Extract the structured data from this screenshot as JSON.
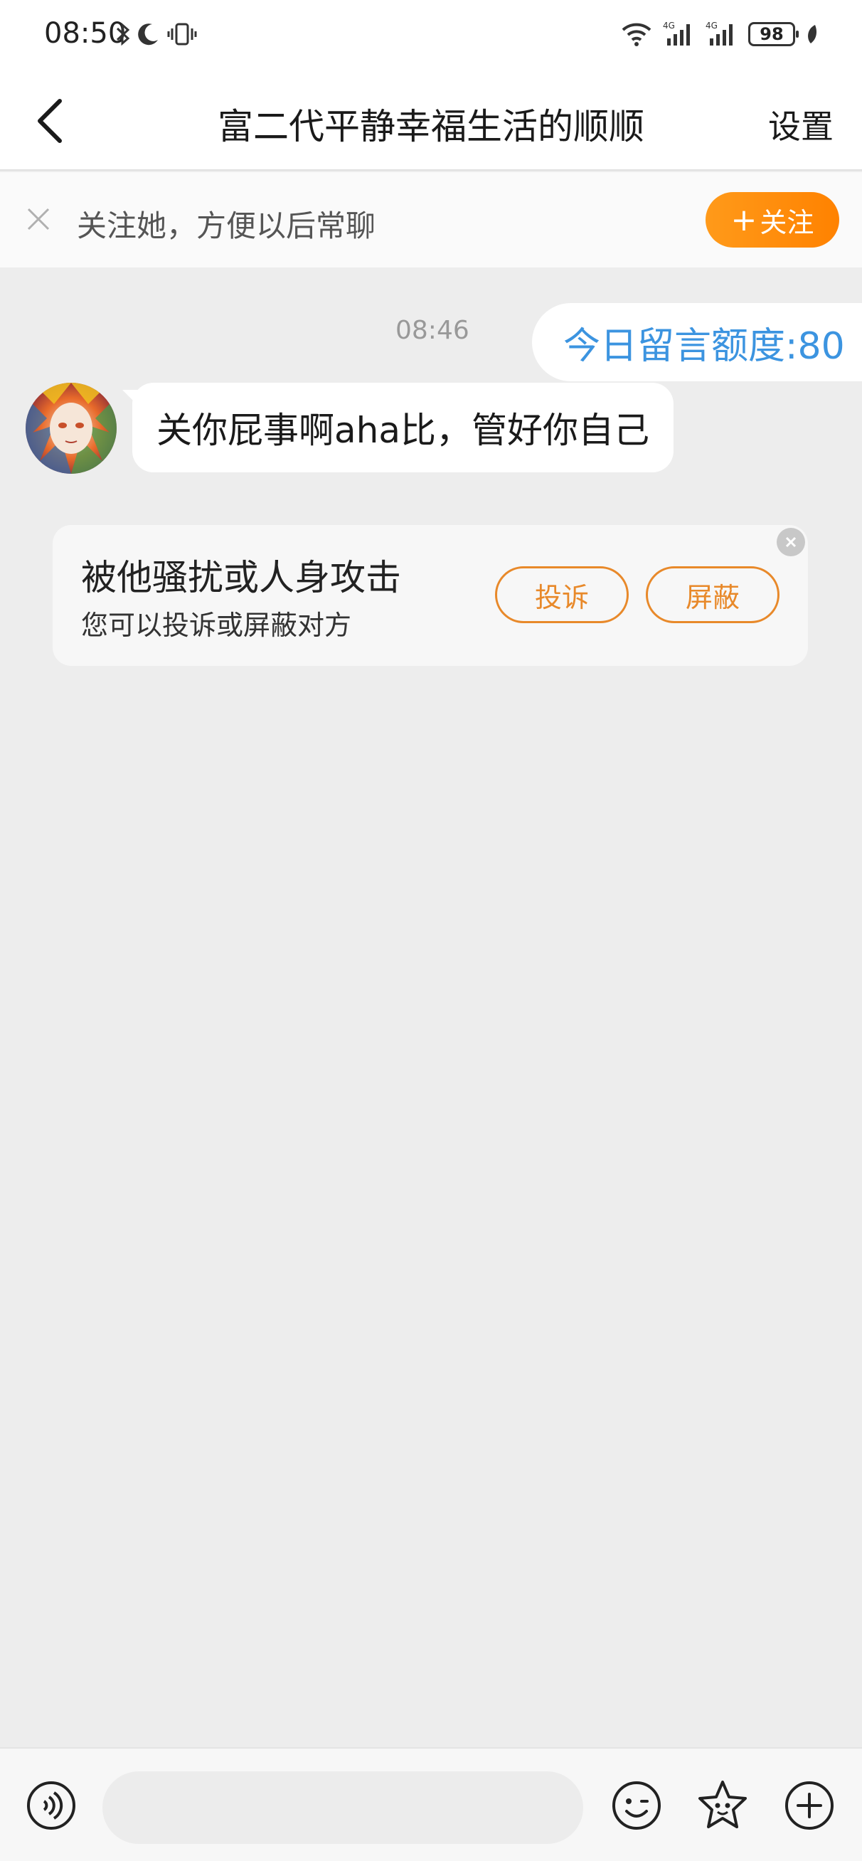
{
  "status_bar": {
    "time": "08:50",
    "battery": "98",
    "icons": [
      "bluetooth-icon",
      "moon-icon",
      "vibrate-icon",
      "wifi-icon",
      "signal-4g-icon",
      "signal-4g-icon",
      "battery-icon",
      "leaf-icon"
    ]
  },
  "nav": {
    "title": "富二代平静幸福生活的顺顺",
    "settings_label": "设置"
  },
  "follow_banner": {
    "text": "关注她，方便以后常聊",
    "button_label": "关注",
    "button_prefix": "+"
  },
  "chat": {
    "timestamp": "08:46",
    "quota_text": "今日留言额度:80",
    "message": "关你屁事啊aha比，管好你自己"
  },
  "report_card": {
    "title": "被他骚扰或人身攻击",
    "subtitle": "您可以投诉或屏蔽对方",
    "complain_label": "投诉",
    "block_label": "屏蔽"
  },
  "input_bar": {
    "placeholder": ""
  },
  "colors": {
    "accent_orange": "#ff8200",
    "link_blue": "#3c94e0",
    "background": "#ededed"
  }
}
